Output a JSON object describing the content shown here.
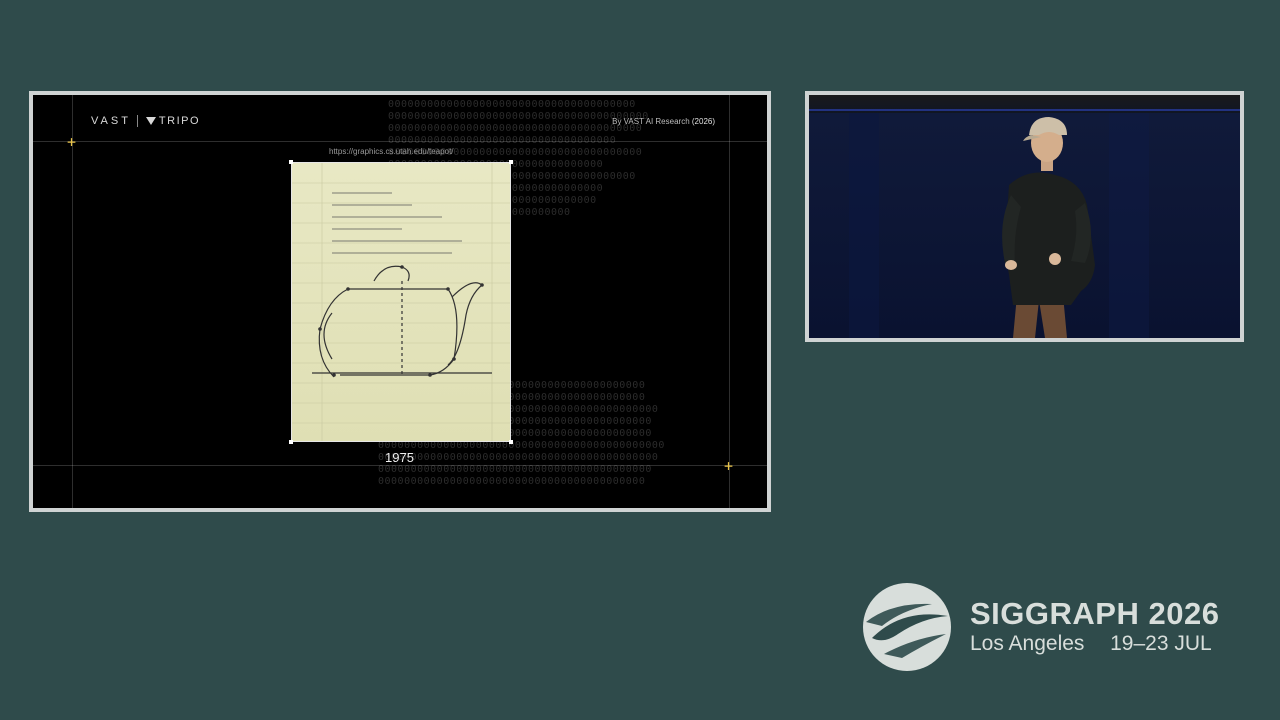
{
  "slide": {
    "logo_vast": "VAST",
    "logo_tripo": "TRIPO",
    "credit": "By VAST AI Research",
    "credit_year": "(2026)",
    "url": "https://graphics.cs.utah.edu/teapot/",
    "year_caption": "1975",
    "accent_color": "#e8c34a"
  },
  "brand": {
    "title": "SIGGRAPH 2026",
    "location": "Los Angeles",
    "dates": "19–23 JUL"
  }
}
